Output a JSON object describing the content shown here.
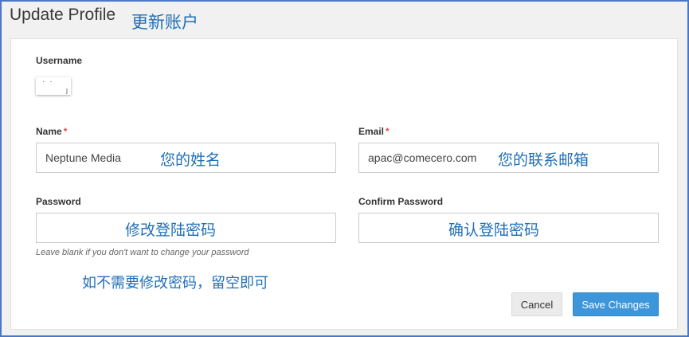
{
  "header": {
    "title": "Update Profile",
    "title_annotation": "更新账户"
  },
  "form": {
    "username": {
      "label": "Username"
    },
    "name": {
      "label": "Name",
      "required_marker": "*",
      "value": "Neptune Media",
      "annotation": "您的姓名"
    },
    "email": {
      "label": "Email",
      "required_marker": "*",
      "value": "apac@comecero.com",
      "annotation": "您的联系邮箱"
    },
    "password": {
      "label": "Password",
      "value": "",
      "annotation": "修改登陆密码"
    },
    "confirm_password": {
      "label": "Confirm Password",
      "value": "",
      "annotation": "确认登陆密码"
    },
    "hint": "Leave blank if you don't want to change your password",
    "hint_annotation": "如不需要修改密码，留空即可"
  },
  "actions": {
    "cancel_label": "Cancel",
    "save_label": "Save Changes"
  },
  "colors": {
    "primary": "#3c96d9",
    "annotation": "#1f6fb8",
    "required": "#d9534f",
    "frame_border": "#4a78c8"
  }
}
